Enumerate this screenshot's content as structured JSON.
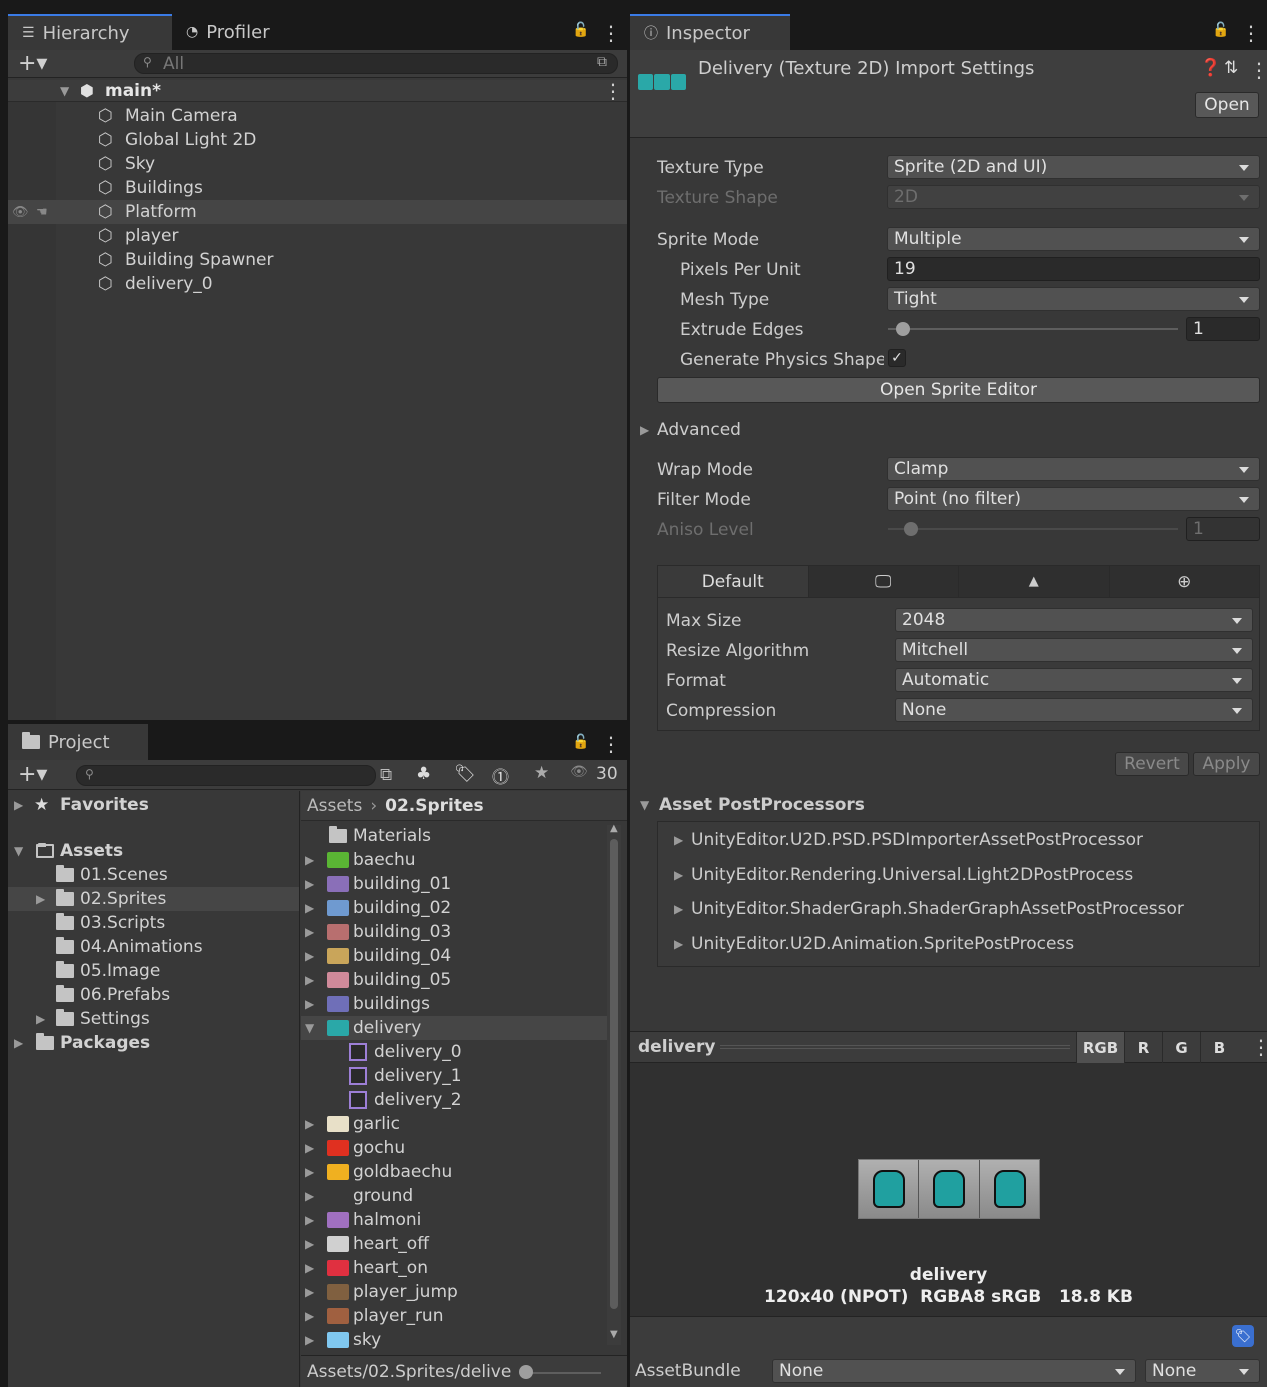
{
  "hierarchy": {
    "tab_label": "Hierarchy",
    "profiler_tab_label": "Profiler",
    "search_placeholder": "All",
    "scene_name": "main*",
    "items": [
      "Main Camera",
      "Global Light 2D",
      "Sky",
      "Buildings",
      "Platform",
      "player",
      "Building Spawner",
      "delivery_0"
    ]
  },
  "project": {
    "tab_label": "Project",
    "count_label": "30",
    "favorites_label": "Favorites",
    "assets_label": "Assets",
    "folders": [
      "01.Scenes",
      "02.Sprites",
      "03.Scripts",
      "04.Animations",
      "05.Image",
      "06.Prefabs",
      "Settings"
    ],
    "packages_label": "Packages",
    "breadcrumb_root": "Assets",
    "breadcrumb_current": "02.Sprites",
    "files": [
      {
        "name": "Materials",
        "kind": "folder",
        "color": "#c4c4c4"
      },
      {
        "name": "baechu",
        "kind": "sprite",
        "color": "#5ab534"
      },
      {
        "name": "building_01",
        "kind": "sprite",
        "color": "#8a6fb8"
      },
      {
        "name": "building_02",
        "kind": "sprite",
        "color": "#6f9ad0"
      },
      {
        "name": "building_03",
        "kind": "sprite",
        "color": "#b86f6f"
      },
      {
        "name": "building_04",
        "kind": "sprite",
        "color": "#c9a55a"
      },
      {
        "name": "building_05",
        "kind": "sprite",
        "color": "#d08a9a"
      },
      {
        "name": "buildings",
        "kind": "sprite",
        "color": "#6f6fb8"
      },
      {
        "name": "delivery",
        "kind": "sprite",
        "color": "#2aa8a8"
      },
      {
        "name": "delivery_0",
        "kind": "subsprite",
        "color": "#9d7fd6"
      },
      {
        "name": "delivery_1",
        "kind": "subsprite",
        "color": "#9d7fd6"
      },
      {
        "name": "delivery_2",
        "kind": "subsprite",
        "color": "#9d7fd6"
      },
      {
        "name": "garlic",
        "kind": "sprite",
        "color": "#e8e0c8"
      },
      {
        "name": "gochu",
        "kind": "sprite",
        "color": "#e03020"
      },
      {
        "name": "goldbaechu",
        "kind": "sprite",
        "color": "#f0b020"
      },
      {
        "name": "ground",
        "kind": "sprite",
        "color": "#383838"
      },
      {
        "name": "halmoni",
        "kind": "sprite",
        "color": "#a070c0"
      },
      {
        "name": "heart_off",
        "kind": "sprite",
        "color": "#d0d0d0"
      },
      {
        "name": "heart_on",
        "kind": "sprite",
        "color": "#e03040"
      },
      {
        "name": "player_jump",
        "kind": "sprite",
        "color": "#806040"
      },
      {
        "name": "player_run",
        "kind": "sprite",
        "color": "#a06040"
      },
      {
        "name": "sky",
        "kind": "sprite",
        "color": "#80c8f0"
      }
    ],
    "footer_path": "Assets/02.Sprites/delive"
  },
  "inspector": {
    "tab_label": "Inspector",
    "title": "Delivery (Texture 2D) Import Settings",
    "open_button": "Open",
    "texture_type_label": "Texture Type",
    "texture_type_value": "Sprite (2D and UI)",
    "texture_shape_label": "Texture Shape",
    "texture_shape_value": "2D",
    "sprite_mode_label": "Sprite Mode",
    "sprite_mode_value": "Multiple",
    "ppu_label": "Pixels Per Unit",
    "ppu_value": "19",
    "mesh_type_label": "Mesh Type",
    "mesh_type_value": "Tight",
    "extrude_label": "Extrude Edges",
    "extrude_value": "1",
    "physics_label": "Generate Physics Shape",
    "sprite_editor_button": "Open Sprite Editor",
    "advanced_label": "Advanced",
    "wrap_label": "Wrap Mode",
    "wrap_value": "Clamp",
    "filter_label": "Filter Mode",
    "filter_value": "Point (no filter)",
    "aniso_label": "Aniso Level",
    "aniso_value": "1",
    "platform_default": "Default",
    "max_size_label": "Max Size",
    "max_size_value": "2048",
    "resize_label": "Resize Algorithm",
    "resize_value": "Mitchell",
    "format_label": "Format",
    "format_value": "Automatic",
    "compression_label": "Compression",
    "compression_value": "None",
    "revert_button": "Revert",
    "apply_button": "Apply",
    "postprocessors_label": "Asset PostProcessors",
    "postprocessors": [
      "UnityEditor.U2D.PSD.PSDImporterAssetPostProcessor",
      "UnityEditor.Rendering.Universal.Light2DPostProcess",
      "UnityEditor.ShaderGraph.ShaderGraphAssetPostProcessor",
      "UnityEditor.U2D.Animation.SpritePostProcess"
    ],
    "preview_title": "delivery",
    "channels": [
      "RGB",
      "R",
      "G",
      "B"
    ],
    "preview_name": "delivery",
    "preview_info": "120x40 (NPOT)  RGBA8 sRGB   18.8 KB",
    "assetbundle_label": "AssetBundle",
    "assetbundle_value": "None",
    "assetbundle_variant": "None"
  }
}
